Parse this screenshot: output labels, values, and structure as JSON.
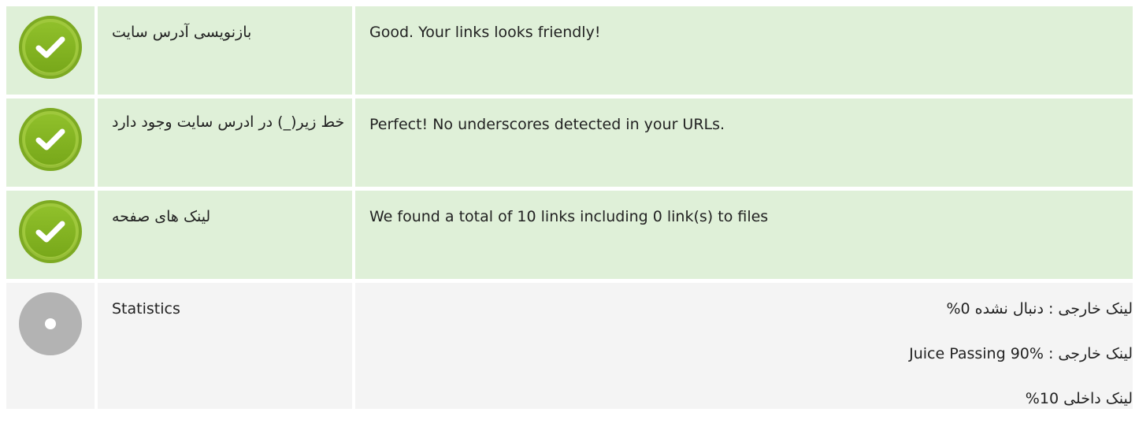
{
  "rows": [
    {
      "status": "good",
      "icon": "check-circle-icon",
      "label": "بازنویسی آدرس سایت",
      "value": "Good. Your links looks friendly!"
    },
    {
      "status": "good",
      "icon": "check-circle-icon",
      "label": "خط زیر(_) در ادرس سایت وجود دارد",
      "value": "Perfect! No underscores detected in your URLs."
    },
    {
      "status": "good",
      "icon": "check-circle-icon",
      "label": "لینک های صفحه",
      "value": "We found a total of 10 links including 0 link(s) to files"
    },
    {
      "status": "neutral",
      "icon": "info-dot-icon",
      "label": "Statistics",
      "stats": [
        "لینک خارجی : دنبال نشده 0%",
        "لینک خارجی : Juice Passing 90%",
        "لینک داخلی 10%"
      ]
    }
  ],
  "colors": {
    "good_bg": "#dff0d8",
    "neutral_bg": "#f4f4f4",
    "check_green": "#8dbd2a",
    "info_grey": "#b3b3b3"
  }
}
